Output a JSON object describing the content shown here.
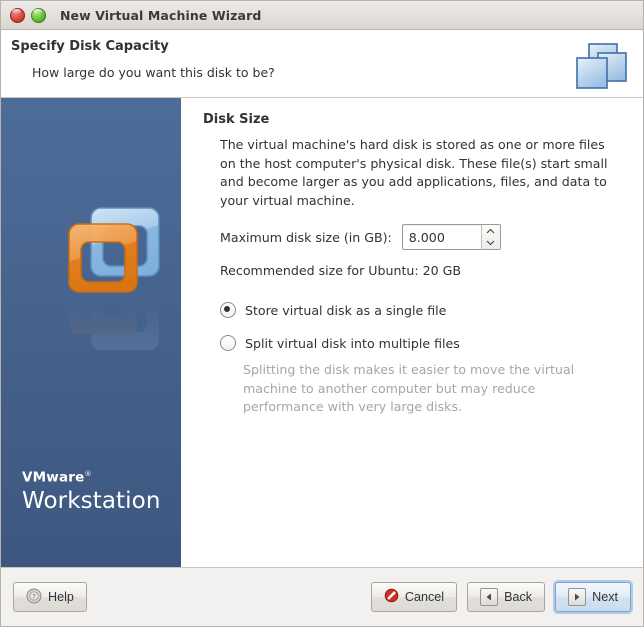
{
  "window": {
    "title": "New Virtual Machine Wizard",
    "close_icon": "close-circle-icon",
    "maximize_icon": "maximize-circle-icon"
  },
  "header": {
    "title": "Specify Disk Capacity",
    "subtitle": "How large do you want this disk to be?",
    "icon": "stacked-disks-icon"
  },
  "sidebar": {
    "logo_icon": "vmware-logo-icon",
    "brand_top": "VMware",
    "brand_trademark": "®",
    "brand_main": "Workstation"
  },
  "content": {
    "section_title": "Disk Size",
    "description": "The virtual machine's hard disk is stored as one or more files on the host computer's physical disk. These file(s) start small and become larger as you add applications, files, and data to your virtual machine.",
    "field_label": "Maximum disk size (in GB):",
    "disk_size_value": "8.000",
    "disk_size_placeholder": "8.000",
    "spin_up_icon": "chevron-up-icon",
    "spin_down_icon": "chevron-down-icon",
    "recommendation": "Recommended size for Ubuntu: 20 GB",
    "options": [
      {
        "label": "Store virtual disk as a single file",
        "selected": true
      },
      {
        "label": "Split virtual disk into multiple files",
        "selected": false
      }
    ],
    "hint": "Splitting the disk makes it easier to move the virtual machine to another computer but may reduce performance with very large disks."
  },
  "footer": {
    "help_label": "Help",
    "help_icon": "help-question-icon",
    "cancel_label": "Cancel",
    "cancel_icon": "cancel-prohibition-icon",
    "back_label": "Back",
    "back_icon": "arrow-left-icon",
    "next_label": "Next",
    "next_icon": "arrow-right-icon"
  },
  "colors": {
    "sidebar_top": "#4d6d99",
    "sidebar_bottom": "#3d5780",
    "text": "#2e3436",
    "hint_text": "#a6a6a6",
    "accent": "#aecbe8",
    "logo_orange": "#ef8b33",
    "logo_blue": "#9dc5e8",
    "cancel_red": "#cc2f26"
  }
}
